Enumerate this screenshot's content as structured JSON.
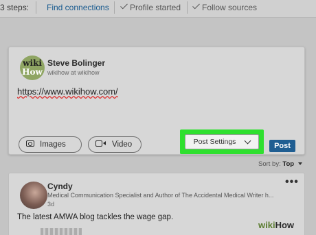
{
  "steps": {
    "prefix": "3 steps:",
    "find_connections": "Find connections",
    "profile_started": "Profile started",
    "follow_sources": "Follow sources"
  },
  "composer": {
    "avatar_logo": {
      "line1": "wiki",
      "line2": "How"
    },
    "author_name": "Steve Bolinger",
    "author_subtitle": "wikihow at wikihow",
    "post_text": "https://www.wikihow.com/",
    "images_label": "Images",
    "video_label": "Video",
    "post_settings_label": "Post Settings",
    "post_label": "Post"
  },
  "sort": {
    "prefix": "Sort by:",
    "value": "Top"
  },
  "feed_post": {
    "name": "Cyndy",
    "headline": "Medical Communication Specialist and Author of The Accidental Medical Writer h...",
    "time": "3d",
    "text": "The latest AMWA blog tackles the wage gap."
  },
  "watermark": {
    "part1": "wiki",
    "part2": "How"
  },
  "colors": {
    "highlight": "#2fe02f",
    "post_button": "#1f5e92",
    "link": "#1a5b8f"
  },
  "icons": [
    "check-icon",
    "camera-icon",
    "video-icon",
    "chevron-down-icon",
    "more-icon",
    "caret-down-icon"
  ]
}
